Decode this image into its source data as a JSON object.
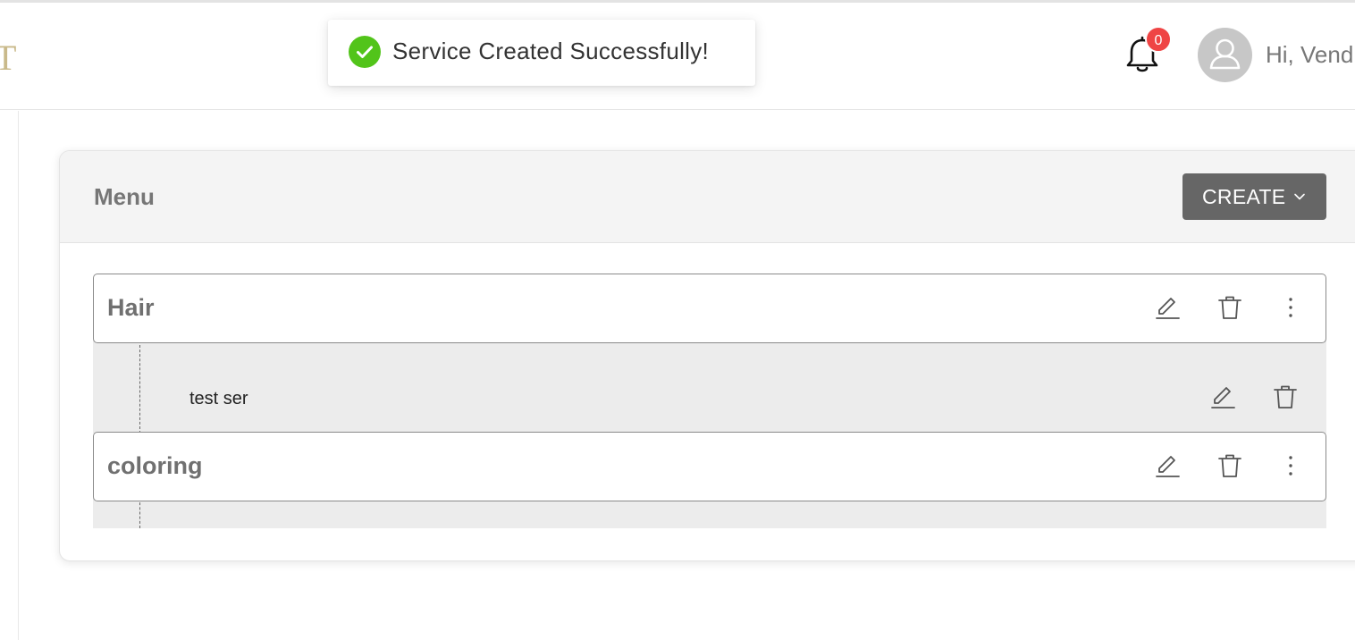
{
  "header": {
    "logo_text": "T",
    "notifications_count": "0",
    "greeting": "Hi, Vend"
  },
  "toast": {
    "message": "Service Created Successfully!",
    "status_color": "#52c41a"
  },
  "menu": {
    "title": "Menu",
    "create_label": "CREATE",
    "categories": [
      {
        "name": "Hair",
        "services": [
          {
            "name": "test ser"
          }
        ]
      },
      {
        "name": "coloring",
        "services": []
      }
    ]
  },
  "colors": {
    "badge": "#ef4444",
    "create_button": "#666666",
    "logo": "#c9b98a"
  }
}
